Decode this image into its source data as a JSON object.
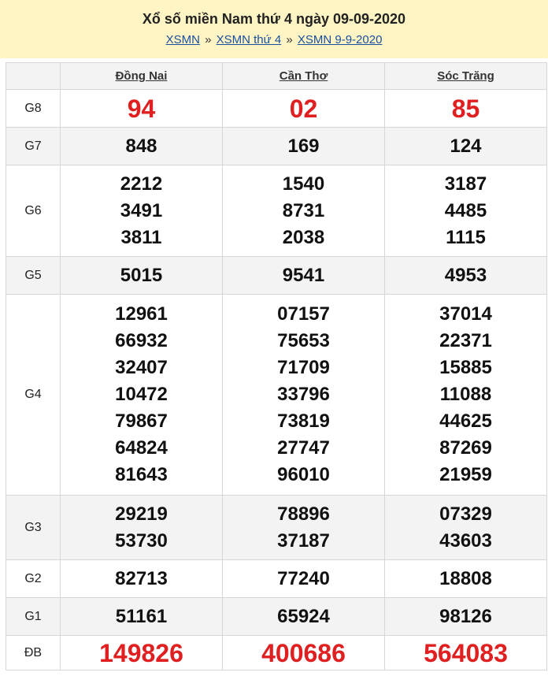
{
  "header": {
    "title": "Xổ số miền Nam thứ 4 ngày 09-09-2020",
    "breadcrumbs": [
      "XSMN",
      "XSMN thứ 4",
      "XSMN 9-9-2020"
    ],
    "separator": "»"
  },
  "provinces": [
    "Đồng Nai",
    "Cần Thơ",
    "Sóc Trăng"
  ],
  "rows": [
    {
      "prize": "G8",
      "cols": [
        [
          "94"
        ],
        [
          "02"
        ],
        [
          "85"
        ]
      ]
    },
    {
      "prize": "G7",
      "cols": [
        [
          "848"
        ],
        [
          "169"
        ],
        [
          "124"
        ]
      ]
    },
    {
      "prize": "G6",
      "cols": [
        [
          "2212",
          "3491",
          "3811"
        ],
        [
          "1540",
          "8731",
          "2038"
        ],
        [
          "3187",
          "4485",
          "1115"
        ]
      ]
    },
    {
      "prize": "G5",
      "cols": [
        [
          "5015"
        ],
        [
          "9541"
        ],
        [
          "4953"
        ]
      ]
    },
    {
      "prize": "G4",
      "cols": [
        [
          "12961",
          "66932",
          "32407",
          "10472",
          "79867",
          "64824",
          "81643"
        ],
        [
          "07157",
          "75653",
          "71709",
          "33796",
          "73819",
          "27747",
          "96010"
        ],
        [
          "37014",
          "22371",
          "15885",
          "11088",
          "44625",
          "87269",
          "21959"
        ]
      ]
    },
    {
      "prize": "G3",
      "cols": [
        [
          "29219",
          "53730"
        ],
        [
          "78896",
          "37187"
        ],
        [
          "07329",
          "43603"
        ]
      ]
    },
    {
      "prize": "G2",
      "cols": [
        [
          "82713"
        ],
        [
          "77240"
        ],
        [
          "18808"
        ]
      ]
    },
    {
      "prize": "G1",
      "cols": [
        [
          "51161"
        ],
        [
          "65924"
        ],
        [
          "98126"
        ]
      ]
    },
    {
      "prize": "ĐB",
      "cols": [
        [
          "149826"
        ],
        [
          "400686"
        ],
        [
          "564083"
        ]
      ]
    }
  ],
  "colors": {
    "highlight": "#e02020",
    "header_bg": "#fff5c4",
    "link": "#1a4fa0"
  }
}
